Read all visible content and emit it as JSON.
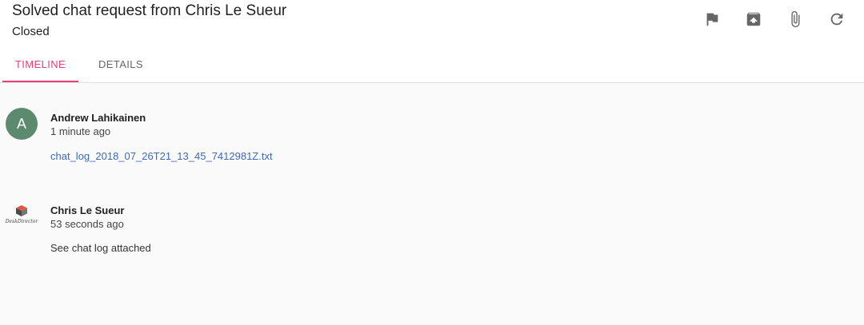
{
  "header": {
    "title": "Solved chat request from Chris Le Sueur",
    "status": "Closed",
    "actions": [
      {
        "icon": "flag-icon"
      },
      {
        "icon": "archive-icon"
      },
      {
        "icon": "paperclip-icon"
      },
      {
        "icon": "refresh-icon"
      }
    ]
  },
  "tabs": [
    {
      "label": "TIMELINE",
      "active": true
    },
    {
      "label": "DETAILS",
      "active": false
    }
  ],
  "timeline": {
    "entries": [
      {
        "avatar_letter": "A",
        "author": "Andrew Lahikainen",
        "time": "1 minute ago",
        "attachment": "chat_log_2018_07_26T21_13_45_7412981Z.txt"
      },
      {
        "logo_text": "DeskDirector",
        "author": "Chris Le Sueur",
        "time": "53 seconds ago",
        "message": "See chat log attached"
      }
    ]
  },
  "colors": {
    "accent": "#e8407a",
    "link": "#3f6ab7",
    "avatar_bg": "#5c8a6e",
    "icon": "#666666"
  }
}
